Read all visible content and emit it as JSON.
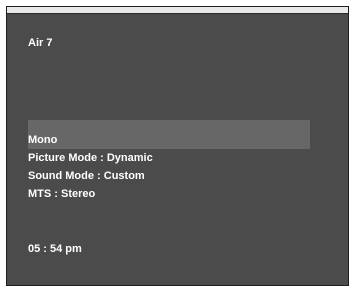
{
  "osd": {
    "channel": "Air 7",
    "audio": "Mono",
    "picture_mode": "Picture Mode : Dynamic",
    "sound_mode": "Sound Mode : Custom",
    "mts": "MTS : Stereo",
    "time": "05 : 54 pm"
  }
}
